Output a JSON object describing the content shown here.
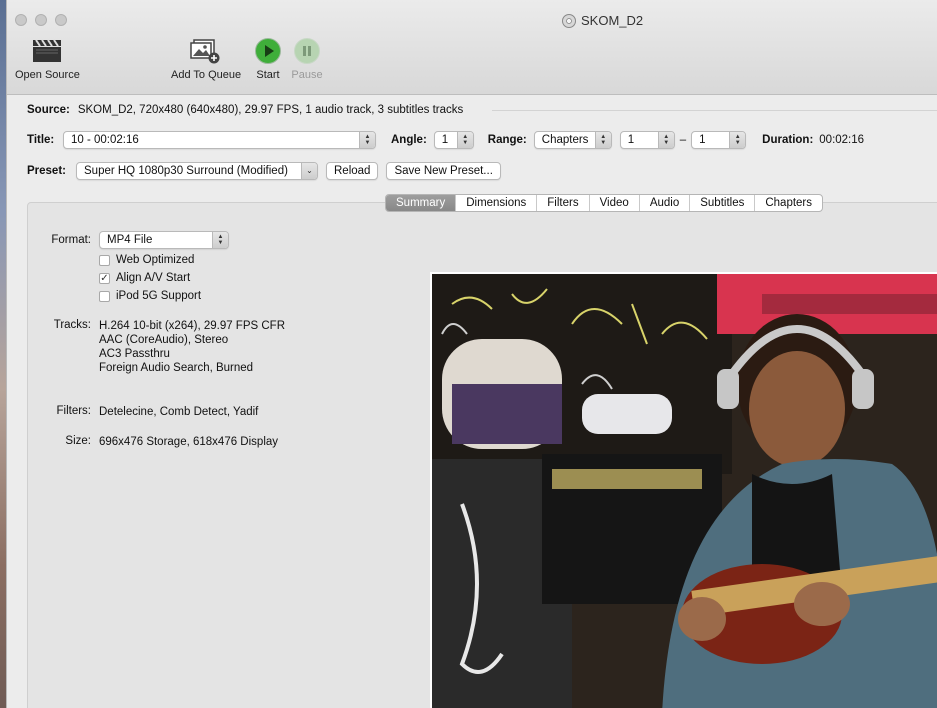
{
  "window": {
    "title": "SKOM_D2"
  },
  "toolbar": {
    "open_source": "Open Source",
    "add_to_queue": "Add To Queue",
    "start": "Start",
    "pause": "Pause"
  },
  "source": {
    "label": "Source:",
    "value": "SKOM_D2, 720x480 (640x480), 29.97 FPS, 1 audio track, 3 subtitles tracks"
  },
  "title_row": {
    "title_label": "Title:",
    "title_value": "10 - 00:02:16",
    "angle_label": "Angle:",
    "angle_value": "1",
    "range_label": "Range:",
    "range_type": "Chapters",
    "range_start": "1",
    "range_dash": "–",
    "range_end": "1",
    "duration_label": "Duration:",
    "duration_value": "00:02:16"
  },
  "preset_row": {
    "label": "Preset:",
    "value": "Super HQ 1080p30 Surround (Modified)",
    "reload": "Reload",
    "save_new": "Save New Preset..."
  },
  "tabs": [
    "Summary",
    "Dimensions",
    "Filters",
    "Video",
    "Audio",
    "Subtitles",
    "Chapters"
  ],
  "summary": {
    "format_label": "Format:",
    "format_value": "MP4 File",
    "options": [
      {
        "label": "Web Optimized",
        "checked": false
      },
      {
        "label": "Align A/V Start",
        "checked": true
      },
      {
        "label": "iPod 5G Support",
        "checked": false
      }
    ],
    "tracks_label": "Tracks:",
    "tracks": [
      "H.264 10-bit (x264), 29.97 FPS CFR",
      "AAC (CoreAudio), Stereo",
      "AC3 Passthru",
      "Foreign Audio Search, Burned"
    ],
    "filters_label": "Filters:",
    "filters_value": "Detelecine, Comb Detect, Yadif",
    "size_label": "Size:",
    "size_value": "696x476 Storage, 618x476 Display"
  },
  "colors": {
    "start_green": "#3fae3a",
    "tab_active": "#8e8e8e"
  }
}
